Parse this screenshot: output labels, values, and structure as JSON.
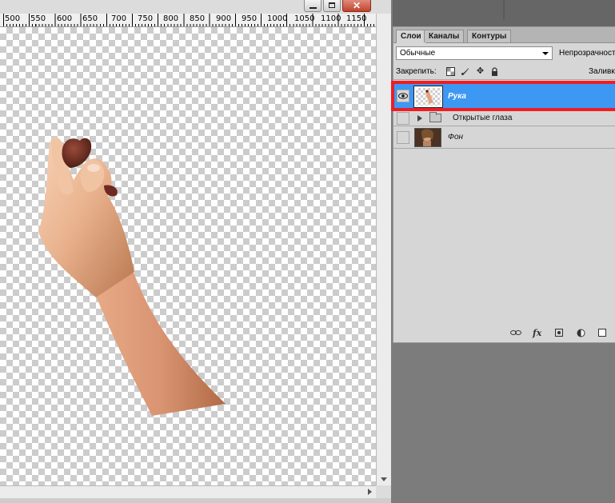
{
  "window": {
    "minimize_icon": "minimize-icon",
    "maximize_icon": "maximize-icon",
    "close_label": "✕"
  },
  "ruler": {
    "labels": [
      "500",
      "550",
      "600",
      "650",
      "700",
      "750",
      "800",
      "850",
      "900",
      "950",
      "1000",
      "1050",
      "1100",
      "1150"
    ]
  },
  "panel": {
    "tabs": [
      "Слои",
      "Каналы",
      "Контуры"
    ],
    "active_tab": "Слои",
    "blend_mode": "Обычные",
    "opacity_label": "Непрозрачность",
    "lock_label": "Закрепить:",
    "fill_label": "Заливка",
    "lock_icons": [
      "lock-transparent-icon",
      "lock-paint-icon",
      "lock-position-icon",
      "lock-all-icon"
    ],
    "layers": [
      {
        "name": "Рука",
        "selected": true,
        "visible": true,
        "type": "pixel"
      },
      {
        "name": "Открытые глаза",
        "selected": false,
        "visible": false,
        "type": "group"
      },
      {
        "name": "Фон",
        "selected": false,
        "visible": false,
        "type": "pixel"
      }
    ],
    "bottom_icons": [
      "link-layers-icon",
      "fx-icon",
      "add-mask-icon",
      "adjustment-layer-icon",
      "new-group-icon"
    ],
    "fx_label": "fx"
  },
  "colors": {
    "selection": "#3d98f4",
    "highlight_frame": "#ee1d23",
    "workspace": "#7c7c7c"
  }
}
